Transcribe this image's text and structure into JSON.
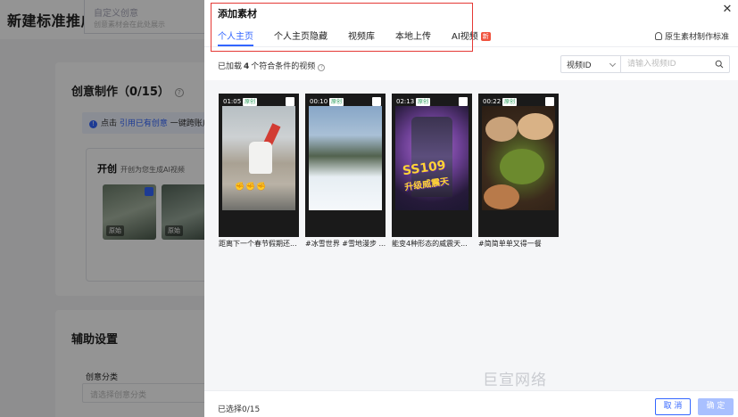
{
  "background": {
    "page_title": "新建标准推广",
    "top_card": {
      "title": "自定义创意",
      "subtitle": "创意素材会在此处展示"
    },
    "creative_section": {
      "title": "创意制作（0/15）",
      "tip_prefix": "点击",
      "tip_link": "引用已有创意",
      "tip_suffix": "一键跨账户",
      "brand": "开创",
      "brand_sub": "开创为您生成AI视频",
      "thumb_tags": [
        "原始",
        "原始"
      ]
    },
    "assist_section": {
      "title": "辅助设置",
      "category_label": "创意分类",
      "category_placeholder": "请选择创意分类"
    }
  },
  "drawer": {
    "title": "添加素材",
    "tabs": [
      {
        "label": "个人主页",
        "active": true
      },
      {
        "label": "个人主页隐藏",
        "active": false
      },
      {
        "label": "视频库",
        "active": false
      },
      {
        "label": "本地上传",
        "active": false
      },
      {
        "label": "AI视频",
        "active": false,
        "badge": "新"
      }
    ],
    "native_standard_link": "原生素材制作标准",
    "count_prefix": "已加载",
    "count_value": "4",
    "count_suffix": "个符合条件的视频",
    "search": {
      "type_value": "视频ID",
      "placeholder": "请输入视频ID"
    },
    "videos": [
      {
        "duration": "01:05",
        "tag": "原创",
        "title": "距离下一个春节假期还..."
      },
      {
        "duration": "00:10",
        "tag": "原创",
        "title": "#冰雪世界 #雪地漫步 ..."
      },
      {
        "duration": "02:13",
        "tag": "原创",
        "title": "能变4种形态的威震天...",
        "overlay_line1": "SS109",
        "overlay_line2": "升级威震天"
      },
      {
        "duration": "00:22",
        "tag": "原创",
        "title": "#简简单单又得一餐"
      }
    ],
    "watermark": "巨宣网络",
    "footer": {
      "selected": "已选择0/15",
      "cancel": "取 消",
      "ok": "确 定"
    }
  },
  "colors": {
    "accent": "#3366ff",
    "highlight_border": "#e53935",
    "badge_new": "#f0533e",
    "ok_disabled": "#a9c0ff"
  }
}
